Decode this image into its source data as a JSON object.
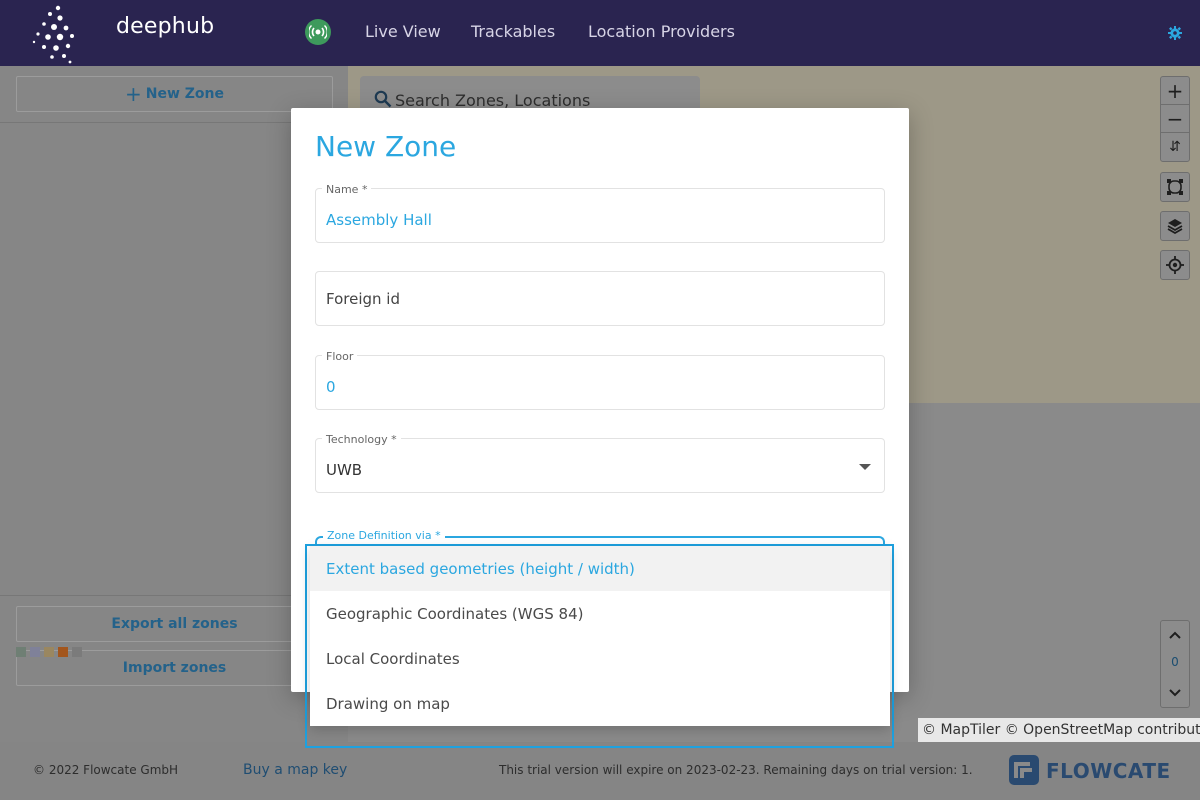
{
  "header": {
    "brand": "deephub",
    "nav": [
      "Live View",
      "Trackables",
      "Location Providers"
    ]
  },
  "sidebar": {
    "new_zone_label": "New Zone",
    "export_label": "Export all zones",
    "import_label": "Import zones",
    "swatch_colors": [
      "#8aa592",
      "#a5a7cc",
      "#c9a975",
      "#d36a22",
      "#9f9f9f"
    ]
  },
  "map": {
    "search_placeholder": "Search Zones, Locations",
    "floor_value": "0",
    "attribution": "© MapTiler © OpenStreetMap contributors"
  },
  "modal": {
    "title": "New Zone",
    "name": {
      "label": "Name *",
      "value": "Assembly Hall"
    },
    "foreign_id": {
      "placeholder": "Foreign id"
    },
    "floor": {
      "label": "Floor",
      "value": "0"
    },
    "technology": {
      "label": "Technology *",
      "value": "UWB"
    },
    "zone_definition": {
      "label": "Zone Definition via   *"
    }
  },
  "dropdown": {
    "options": [
      "Extent based geometries (height / width)",
      "Geographic Coordinates (WGS 84)",
      "Local Coordinates",
      "Drawing on map"
    ],
    "selected_index": 0
  },
  "footer": {
    "copyright": "© 2022 Flowcate GmbH",
    "map_key_link": "Buy a map key",
    "trial_notice": "This trial version will expire on 2023-02-23. Remaining days on trial version: 1.",
    "brand": "FLOWCATE"
  },
  "colors": {
    "header_bg": "#2a2450",
    "accent": "#2ba7e0",
    "link": "#1f4d72"
  }
}
